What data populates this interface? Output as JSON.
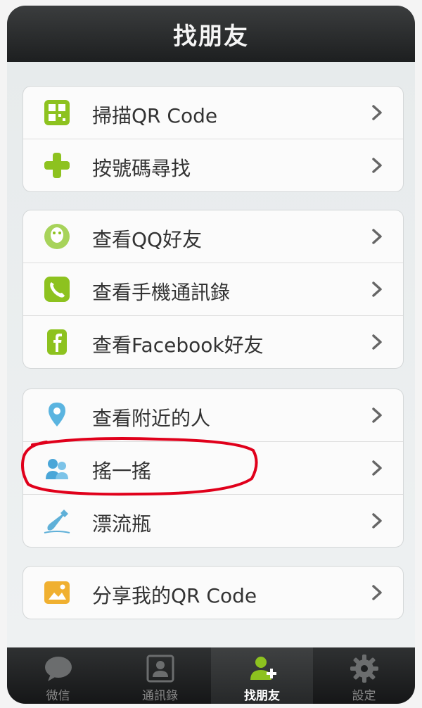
{
  "header": {
    "title": "找朋友"
  },
  "groups": [
    {
      "items": [
        {
          "label": "掃描QR Code",
          "icon": "qr-scan-icon"
        },
        {
          "label": "按號碼尋找",
          "icon": "plus-icon"
        }
      ]
    },
    {
      "items": [
        {
          "label": "查看QQ好友",
          "icon": "qq-icon"
        },
        {
          "label": "查看手機通訊錄",
          "icon": "phone-icon"
        },
        {
          "label": "查看Facebook好友",
          "icon": "facebook-icon"
        }
      ]
    },
    {
      "items": [
        {
          "label": "查看附近的人",
          "icon": "location-pin-icon"
        },
        {
          "label": "搖一搖",
          "icon": "shake-icon"
        },
        {
          "label": "漂流瓶",
          "icon": "bottle-icon"
        }
      ]
    },
    {
      "items": [
        {
          "label": "分享我的QR Code",
          "icon": "share-qr-icon"
        }
      ]
    }
  ],
  "tabs": [
    {
      "label": "微信",
      "icon": "chat-bubble-icon",
      "active": false
    },
    {
      "label": "通訊錄",
      "icon": "contacts-icon",
      "active": false
    },
    {
      "label": "找朋友",
      "icon": "find-friends-icon",
      "active": true
    },
    {
      "label": "設定",
      "icon": "gear-icon",
      "active": false
    }
  ],
  "colors": {
    "accent_green": "#8dc21f",
    "highlight_red": "#e0001b",
    "bar_dark": "#1d1f20"
  }
}
